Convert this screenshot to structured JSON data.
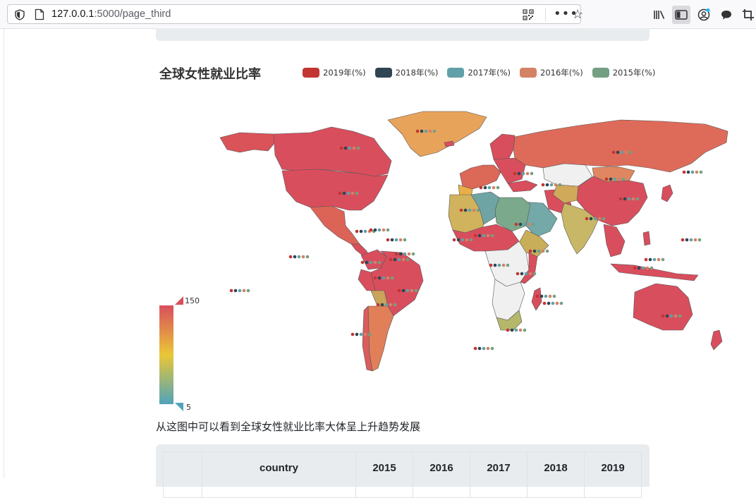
{
  "browser": {
    "url_host": "127.0.0.1",
    "url_rest": ":5000/page_third"
  },
  "chart": {
    "title": "全球女性就业比率",
    "legend": [
      {
        "label": "2019年(%)",
        "color": "#c23531"
      },
      {
        "label": "2018年(%)",
        "color": "#2f4554"
      },
      {
        "label": "2017年(%)",
        "color": "#61a0a8"
      },
      {
        "label": "2016年(%)",
        "color": "#d48265"
      },
      {
        "label": "2015年(%)",
        "color": "#749f83"
      }
    ],
    "visual_map": {
      "max": "150",
      "min": "5",
      "colors": [
        "#d94e5d",
        "#eac736",
        "#50a3ba"
      ]
    }
  },
  "caption": "从这图中可以看到全球女性就业比率大体呈上升趋势发展",
  "table": {
    "headers": [
      "",
      "country",
      "2015",
      "2016",
      "2017",
      "2018",
      "2019"
    ]
  },
  "chart_data": {
    "type": "map",
    "title": "全球女性就业比率",
    "series": [
      {
        "name": "2019年(%)"
      },
      {
        "name": "2018年(%)"
      },
      {
        "name": "2017年(%)"
      },
      {
        "name": "2016年(%)"
      },
      {
        "name": "2015年(%)"
      }
    ],
    "visual_map_range": [
      5,
      150
    ]
  }
}
